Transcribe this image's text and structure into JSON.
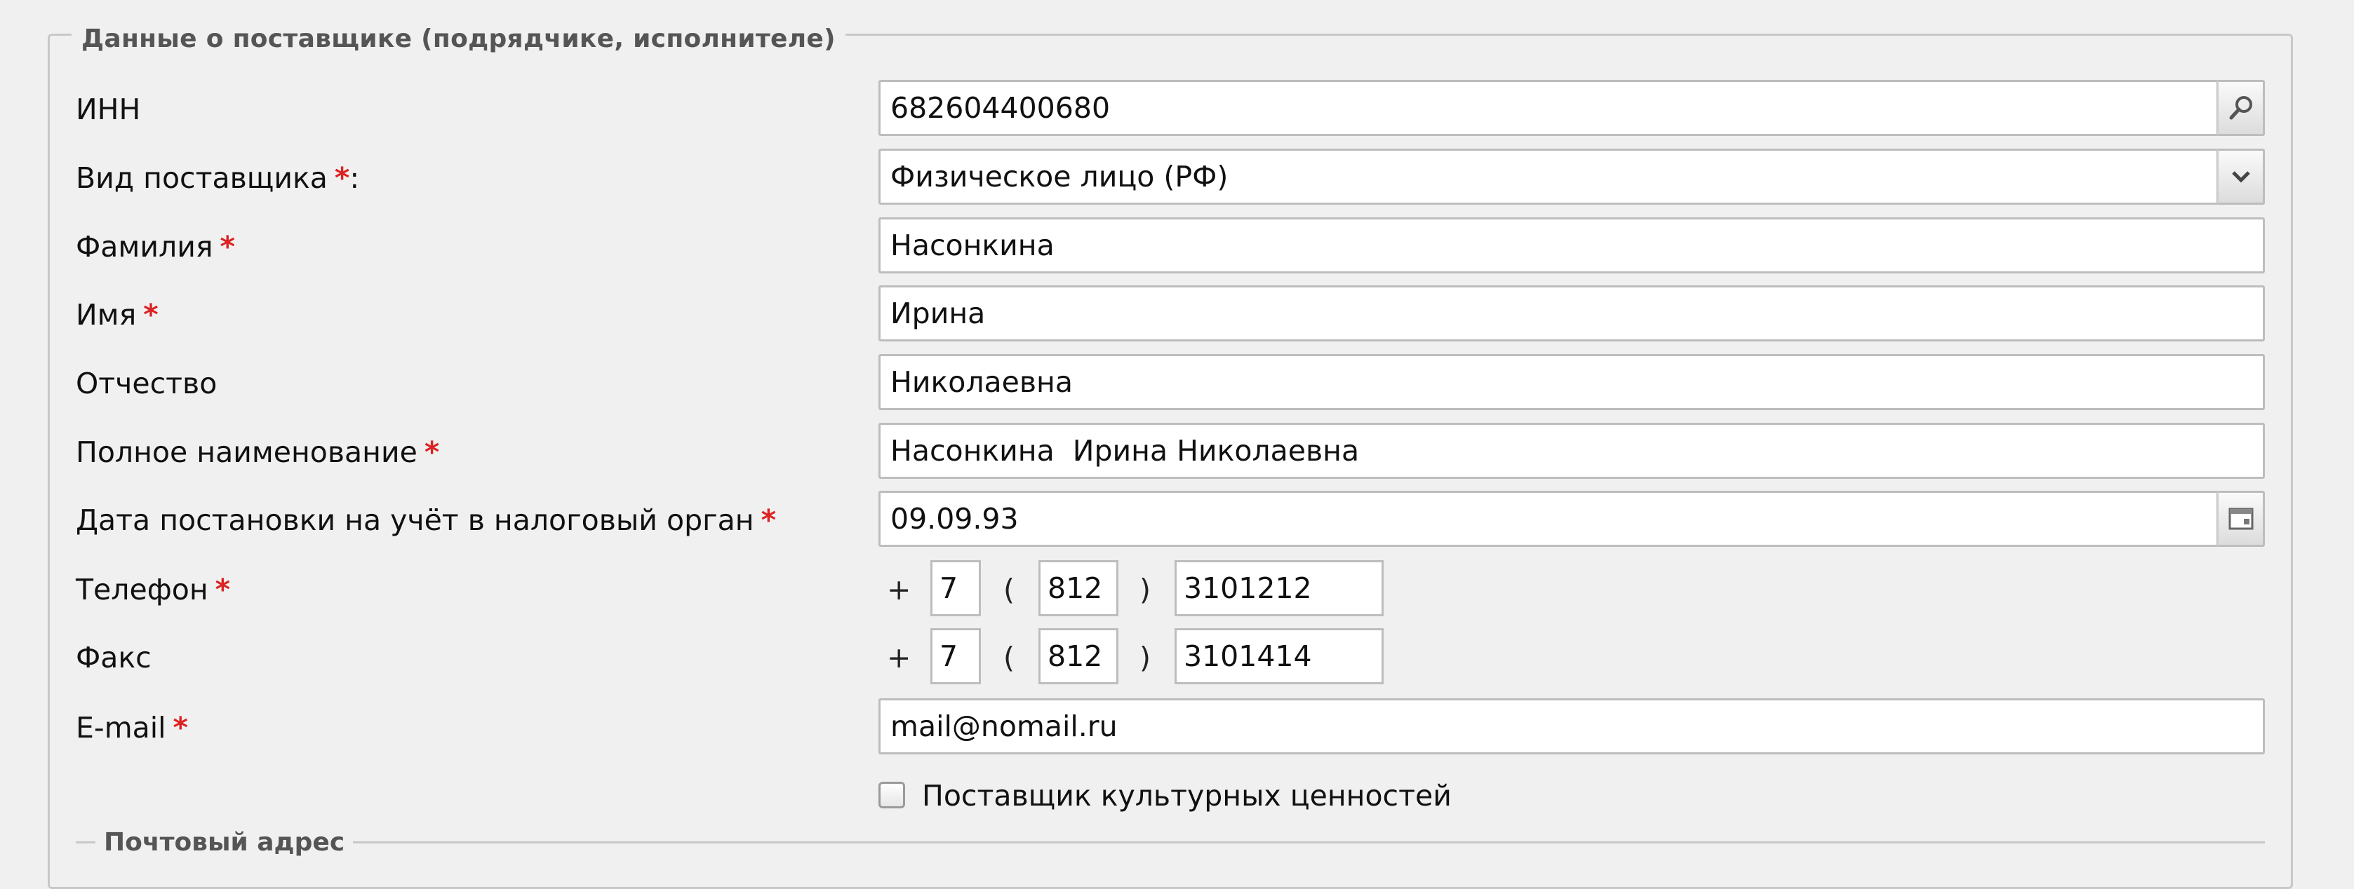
{
  "section": {
    "legend": "Данные о поставщике (подрядчике, исполнителе)",
    "postal_legend": "Почтовый адрес"
  },
  "fields": {
    "inn": {
      "label": "ИНН",
      "value": "682604400680"
    },
    "supplier_type": {
      "label": "Вид поставщика",
      "suffix": ":",
      "value": "Физическое лицо (РФ)"
    },
    "last_name": {
      "label": "Фамилия",
      "value": "Насонкина"
    },
    "first_name": {
      "label": "Имя",
      "value": "Ирина"
    },
    "patronymic": {
      "label": "Отчество",
      "value": "Николаевна"
    },
    "full_name": {
      "label": "Полное наименование",
      "value": "Насонкина  Ирина Николаевна"
    },
    "tax_date": {
      "label": "Дата постановки на учёт в налоговый орган",
      "value": "09.09.93"
    },
    "phone": {
      "label": "Телефон",
      "country": "7",
      "area": "812",
      "number": "3101212"
    },
    "fax": {
      "label": "Факс",
      "country": "7",
      "area": "812",
      "number": "3101414"
    },
    "email": {
      "label": "E-mail",
      "value": "mail@nomail.ru"
    },
    "cultural": {
      "label": "Поставщик культурных ценностей",
      "checked": false
    }
  },
  "symbols": {
    "required": "*",
    "plus": "+",
    "open_paren": "(",
    "close_paren": ")"
  },
  "icons": {
    "inn_search": "search-icon",
    "supplier_dropdown": "chevron-down-icon",
    "date_picker": "calendar-icon"
  },
  "colors": {
    "required": "#dd2222",
    "border": "#bdbdbd",
    "background": "#f0f0f0"
  }
}
